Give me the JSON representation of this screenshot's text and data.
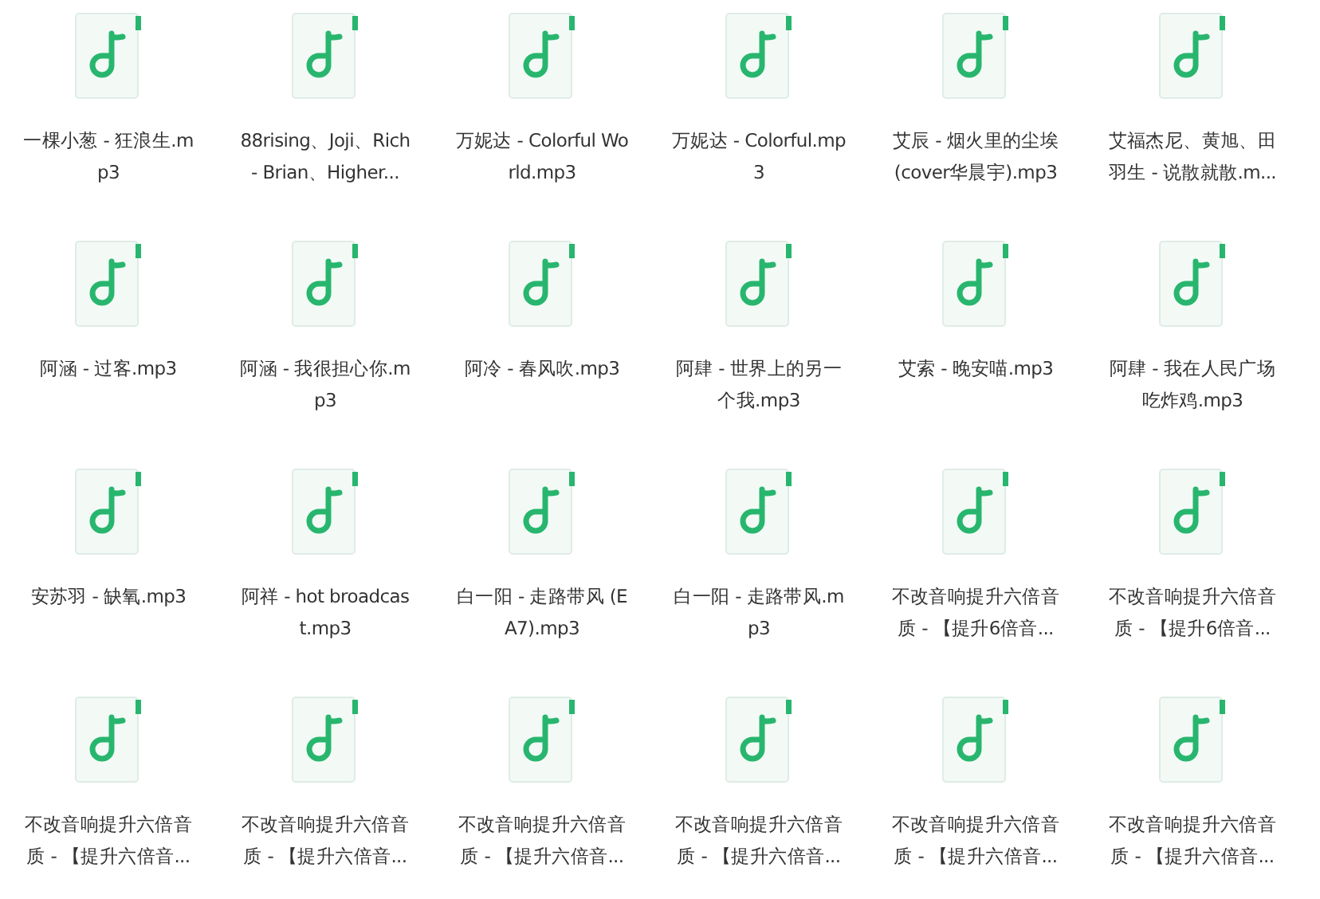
{
  "files": [
    {
      "name": "一棵小葱 - 狂浪生.mp3"
    },
    {
      "name": "88rising、Joji、Rich - Brian、Higher..."
    },
    {
      "name": "万妮达 - Colorful World.mp3"
    },
    {
      "name": "万妮达 - Colorful.mp3"
    },
    {
      "name": "艾辰 - 烟火里的尘埃(cover华晨宇).mp3"
    },
    {
      "name": "艾福杰尼、黄旭、田羽生 - 说散就散.m..."
    },
    {
      "name": "阿涵 - 过客.mp3"
    },
    {
      "name": "阿涵 - 我很担心你.mp3"
    },
    {
      "name": "阿冷 - 春风吹.mp3"
    },
    {
      "name": "阿肆 - 世界上的另一个我.mp3"
    },
    {
      "name": "艾索 - 晚安喵.mp3"
    },
    {
      "name": "阿肆 - 我在人民广场吃炸鸡.mp3"
    },
    {
      "name": "安苏羽 - 缺氧.mp3"
    },
    {
      "name": "阿祥 - hot broadcast.mp3"
    },
    {
      "name": "白一阳 - 走路带风 (EA7).mp3"
    },
    {
      "name": "白一阳 - 走路带风.mp3"
    },
    {
      "name": "不改音响提升六倍音质 - 【提升6倍音..."
    },
    {
      "name": "不改音响提升六倍音质 - 【提升6倍音..."
    },
    {
      "name": "不改音响提升六倍音质 - 【提升六倍音..."
    },
    {
      "name": "不改音响提升六倍音质 - 【提升六倍音..."
    },
    {
      "name": "不改音响提升六倍音质 - 【提升六倍音..."
    },
    {
      "name": "不改音响提升六倍音质 - 【提升六倍音..."
    },
    {
      "name": "不改音响提升六倍音质 - 【提升六倍音..."
    },
    {
      "name": "不改音响提升六倍音质 - 【提升六倍音..."
    }
  ]
}
